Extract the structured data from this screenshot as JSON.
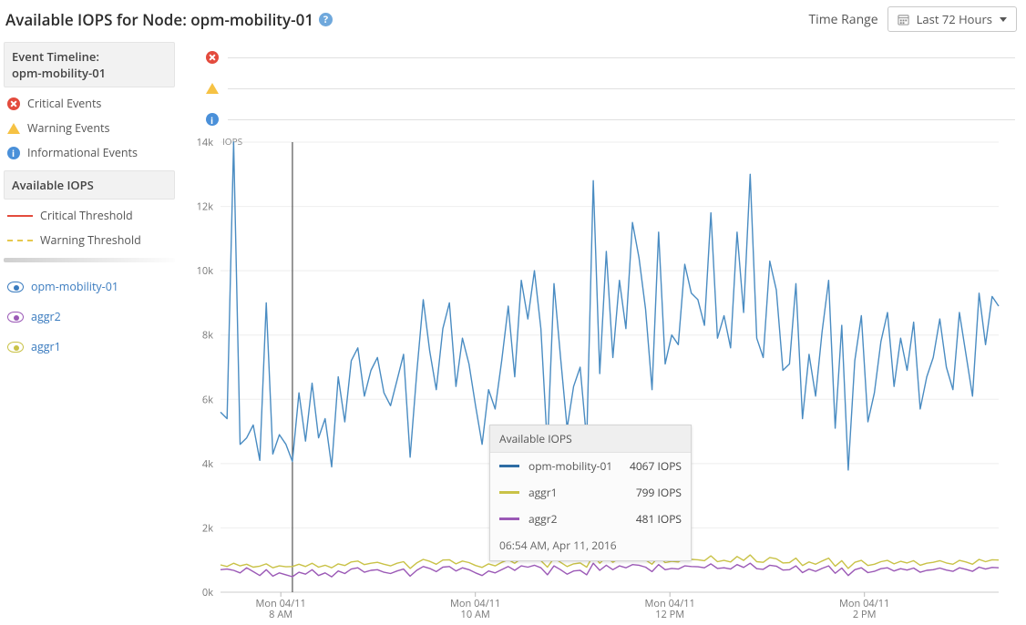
{
  "header": {
    "title": "Available IOPS for Node: opm-mobility-01",
    "time_range_label": "Time Range",
    "time_range_value": "Last 72 Hours"
  },
  "sidebar": {
    "timeline_title": "Event Timeline:",
    "timeline_node": "opm-mobility-01",
    "events": [
      {
        "label": "Critical Events"
      },
      {
        "label": "Warning Events"
      },
      {
        "label": "Informational Events"
      }
    ],
    "section_title": "Available IOPS",
    "thresholds": [
      {
        "label": "Critical Threshold"
      },
      {
        "label": "Warning Threshold"
      }
    ],
    "legend": [
      {
        "label": "opm-mobility-01",
        "color": "#3a7bbf"
      },
      {
        "label": "aggr2",
        "color": "#9b59b6"
      },
      {
        "label": "aggr1",
        "color": "#c9c247"
      }
    ]
  },
  "tooltip": {
    "title": "Available IOPS",
    "items": [
      {
        "name": "opm-mobility-01",
        "value": "4067 IOPS",
        "color": "#2e6da4"
      },
      {
        "name": "aggr1",
        "value": "799 IOPS",
        "color": "#c9c247"
      },
      {
        "name": "aggr2",
        "value": "481 IOPS",
        "color": "#9b59b6"
      }
    ],
    "timestamp": "06:54 AM, Apr 11, 2016"
  },
  "chart_data": {
    "type": "line",
    "title": "Available IOPS",
    "ylabel": "IOPS",
    "xlabel": "",
    "ylim": [
      0,
      14000
    ],
    "yticks": [
      0,
      2000,
      4000,
      6000,
      8000,
      10000,
      12000,
      14000
    ],
    "ytick_labels": [
      "0k",
      "2k",
      "4k",
      "6k",
      "8k",
      "10k",
      "12k",
      "14k"
    ],
    "xticks": [
      "Mon 04/11 8 AM",
      "Mon 04/11 10 AM",
      "Mon 04/11 12 PM",
      "Mon 04/11 2 PM"
    ],
    "cursor_index": 11,
    "series": [
      {
        "name": "opm-mobility-01",
        "color": "#4a8cc2",
        "values": [
          5600,
          5400,
          14000,
          4600,
          4800,
          5200,
          4100,
          9000,
          4300,
          4900,
          4600,
          4067,
          6200,
          4700,
          6500,
          4800,
          5400,
          3900,
          6700,
          5300,
          7200,
          7600,
          6100,
          6900,
          7300,
          6200,
          5800,
          6600,
          7400,
          4200,
          6800,
          9100,
          7500,
          6300,
          8200,
          9000,
          6400,
          7900,
          7100,
          5800,
          4600,
          6300,
          5700,
          7200,
          8900,
          6700,
          9700,
          8500,
          10000,
          8200,
          4500,
          9600,
          7300,
          5100,
          6400,
          7000,
          4700,
          12800,
          6800,
          10600,
          7300,
          9700,
          8200,
          11500,
          10400,
          8800,
          6300,
          11200,
          7100,
          8000,
          7700,
          10200,
          9300,
          9100,
          8300,
          11800,
          7900,
          8600,
          7600,
          11200,
          8700,
          13000,
          7900,
          7300,
          10300,
          9400,
          6900,
          7100,
          9600,
          5400,
          7400,
          6100,
          8100,
          9700,
          5100,
          8300,
          3800,
          7200,
          8600,
          5300,
          6200,
          7800,
          8700,
          6400,
          7900,
          6900,
          8400,
          5700,
          6700,
          7300,
          8500,
          7000,
          6300,
          8700,
          7400,
          6100,
          9300,
          7700,
          9200,
          8900
        ]
      },
      {
        "name": "aggr1",
        "color": "#c9c247",
        "values": [
          850,
          800,
          900,
          820,
          870,
          780,
          810,
          880,
          760,
          820,
          790,
          799,
          870,
          800,
          900,
          780,
          840,
          760,
          880,
          830,
          940,
          970,
          860,
          900,
          930,
          870,
          820,
          900,
          950,
          740,
          910,
          1020,
          960,
          870,
          1000,
          1010,
          880,
          970,
          920,
          830,
          770,
          880,
          820,
          930,
          1010,
          900,
          1050,
          990,
          1080,
          980,
          780,
          1060,
          930,
          800,
          880,
          910,
          780,
          1150,
          900,
          1090,
          930,
          1060,
          980,
          1120,
          1090,
          1000,
          870,
          1110,
          920,
          960,
          940,
          1070,
          1020,
          1010,
          980,
          1130,
          950,
          990,
          940,
          1110,
          990,
          1160,
          950,
          930,
          1080,
          1040,
          910,
          920,
          1060,
          830,
          940,
          870,
          970,
          1060,
          810,
          980,
          740,
          930,
          990,
          830,
          870,
          950,
          990,
          880,
          960,
          910,
          980,
          840,
          900,
          930,
          980,
          910,
          870,
          990,
          940,
          870,
          1020,
          950,
          1010,
          1000
        ]
      },
      {
        "name": "aggr2",
        "color": "#9b59b6",
        "values": [
          700,
          720,
          680,
          600,
          760,
          640,
          520,
          700,
          500,
          600,
          540,
          481,
          620,
          560,
          700,
          520,
          600,
          480,
          660,
          580,
          720,
          760,
          620,
          680,
          700,
          620,
          580,
          660,
          720,
          500,
          680,
          800,
          740,
          640,
          780,
          800,
          660,
          760,
          700,
          600,
          520,
          660,
          600,
          700,
          800,
          680,
          820,
          780,
          840,
          760,
          540,
          820,
          700,
          560,
          660,
          680,
          540,
          900,
          680,
          840,
          700,
          820,
          760,
          860,
          840,
          780,
          640,
          860,
          700,
          740,
          720,
          820,
          800,
          790,
          760,
          880,
          740,
          760,
          720,
          860,
          770,
          900,
          730,
          710,
          840,
          810,
          690,
          700,
          820,
          610,
          720,
          650,
          740,
          820,
          590,
          750,
          520,
          700,
          760,
          610,
          650,
          730,
          760,
          660,
          730,
          690,
          750,
          620,
          680,
          700,
          750,
          690,
          650,
          760,
          710,
          650,
          780,
          720,
          770,
          760
        ]
      }
    ]
  }
}
